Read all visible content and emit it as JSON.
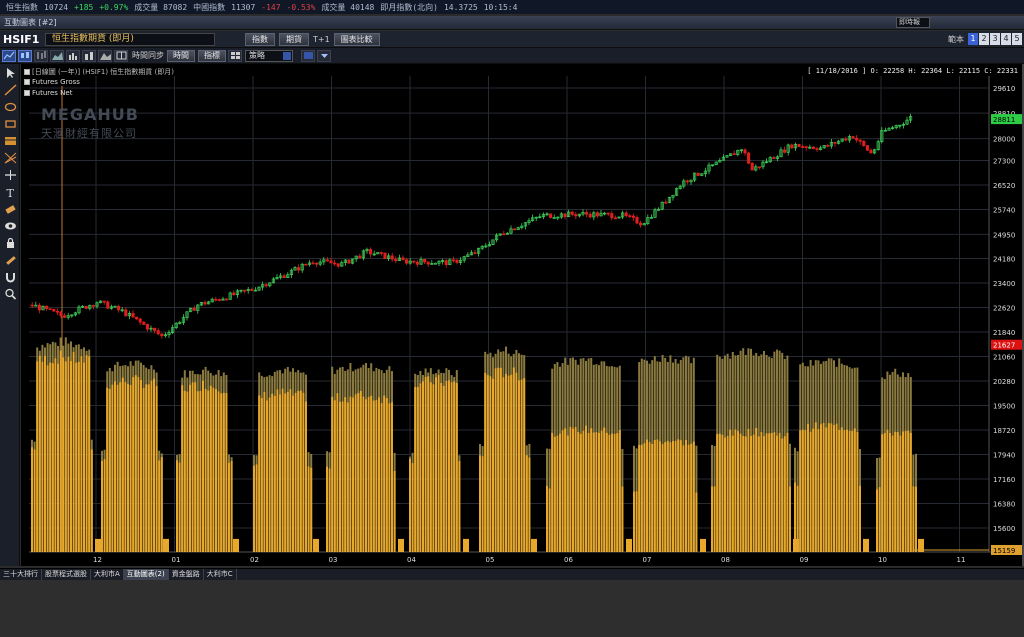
{
  "ticker": {
    "items": [
      {
        "text": "恒生指數",
        "dir": "flat"
      },
      {
        "text": "10724",
        "dir": "flat"
      },
      {
        "text": "+185",
        "dir": "up"
      },
      {
        "text": "+0.97%",
        "dir": "up"
      },
      {
        "text": "成交量 87082",
        "dir": "flat"
      },
      {
        "text": "中國指數",
        "dir": "flat"
      },
      {
        "text": "11307",
        "dir": "flat"
      },
      {
        "text": "-147",
        "dir": "dn"
      },
      {
        "text": "-0.53%",
        "dir": "dn"
      },
      {
        "text": "成交量 40148",
        "dir": "flat"
      },
      {
        "text": "即月指數(北向)",
        "dir": "flat"
      },
      {
        "text": "14.3725",
        "dir": "flat"
      },
      {
        "text": "10:15:4",
        "dir": "flat"
      }
    ]
  },
  "window": {
    "title": "互動圖表 [#2]",
    "period_select": "即時報"
  },
  "header": {
    "symbol": "HSIF1",
    "contract_name": "恒生指數期貨 (即月)",
    "btn_index": "指數",
    "btn_futures": "期貨",
    "t1_label": "T+1",
    "btn_compare": "圖表比較",
    "pages_label": "範本",
    "pages": [
      "1",
      "2",
      "3",
      "4",
      "5"
    ],
    "active_page": "1"
  },
  "toolbar": {
    "sync_label": "時間同步",
    "btn_time": "時間",
    "btn_indicator": "指標",
    "strategy_label": "策略"
  },
  "chart": {
    "series_label": "[日線圖 (一年)]  (HSIF1)  恒生指數期貨 (即月)",
    "legend": [
      "Futures Gross",
      "Futures Net"
    ],
    "watermark_en": "MEGAHUB",
    "watermark_zh": "天滙財經有限公司",
    "ohlc_text": "[ 11/18/2016 ]  O: 22258  H: 22364  L: 22115  C: 22331",
    "y_ticks": [
      29610,
      28810,
      28000,
      27300,
      26520,
      25740,
      24950,
      24180,
      23400,
      22620,
      21840,
      21060,
      20280,
      19500,
      18720,
      17940,
      17160,
      16380,
      15600
    ],
    "x_labels": [
      "12",
      "01",
      "02",
      "03",
      "04",
      "05",
      "06",
      "07",
      "08",
      "09",
      "10",
      "11"
    ],
    "last_price_tag": "28811",
    "volume_tag": "21627",
    "volume_min_tag": "15159",
    "colors": {
      "up": "#3fd35a",
      "down": "#e01f1f",
      "gross": "#8a7a3f",
      "net": "#e8a82b",
      "grid": "#262a33"
    }
  },
  "tabs": {
    "items": [
      "三十大排行",
      "股票程式選股",
      "大利市A",
      "互動圖表(2)",
      "資金盤路",
      "大利市C"
    ],
    "active": "互動圖表(2)"
  }
}
